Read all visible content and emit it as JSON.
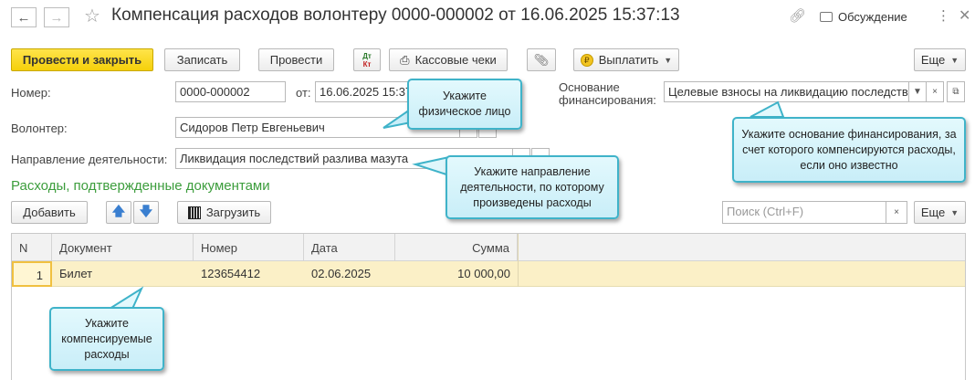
{
  "window": {
    "title": "Компенсация расходов волонтеру 0000-000002 от 16.06.2025 15:37:13",
    "discussion_label": "Обсуждение"
  },
  "toolbar": {
    "post_and_close": "Провести и закрыть",
    "save": "Записать",
    "post": "Провести",
    "dt_kt_line1": "Дт",
    "dt_kt_line2": "Кт",
    "cash_receipts": "Кассовые чеки",
    "pay": "Выплатить",
    "more": "Еще"
  },
  "form": {
    "number_label": "Номер:",
    "number_value": "0000-000002",
    "date_label": "от:",
    "date_value": "16.06.2025 15:37:13",
    "funding_label_line1": "Основание",
    "funding_label_line2": "финансирования:",
    "funding_value": "Целевые взносы на ликвидацию последствий разлива мазута",
    "volunteer_label": "Волонтер:",
    "volunteer_value": "Сидоров Петр Евгеньевич",
    "direction_label": "Направление деятельности:",
    "direction_value": "Ликвидация последствий разлива мазута"
  },
  "expenses": {
    "section_title": "Расходы, подтвержденные документами",
    "add_button": "Добавить",
    "load_button": "Загрузить",
    "search_placeholder": "Поиск (Ctrl+F)",
    "more": "Еще",
    "columns": [
      "N",
      "Документ",
      "Номер",
      "Дата",
      "Сумма"
    ],
    "rows": [
      {
        "n": "1",
        "document": "Билет",
        "number": "123654412",
        "date": "02.06.2025",
        "amount": "10 000,00"
      }
    ]
  },
  "callouts": {
    "volunteer": "Укажите физическое лицо",
    "funding": "Укажите основание финансирования, за счет которого компенсируются расходы, если оно известно",
    "direction": "Укажите направление деятельности, по которому произведены расходы",
    "expenses": "Укажите компенсируемые расходы"
  },
  "colors": {
    "primary_button": "#f5d00a",
    "section_title": "#3c9d3c",
    "selected_row": "#fbf0c7",
    "callout_border": "#3fb3c9"
  }
}
